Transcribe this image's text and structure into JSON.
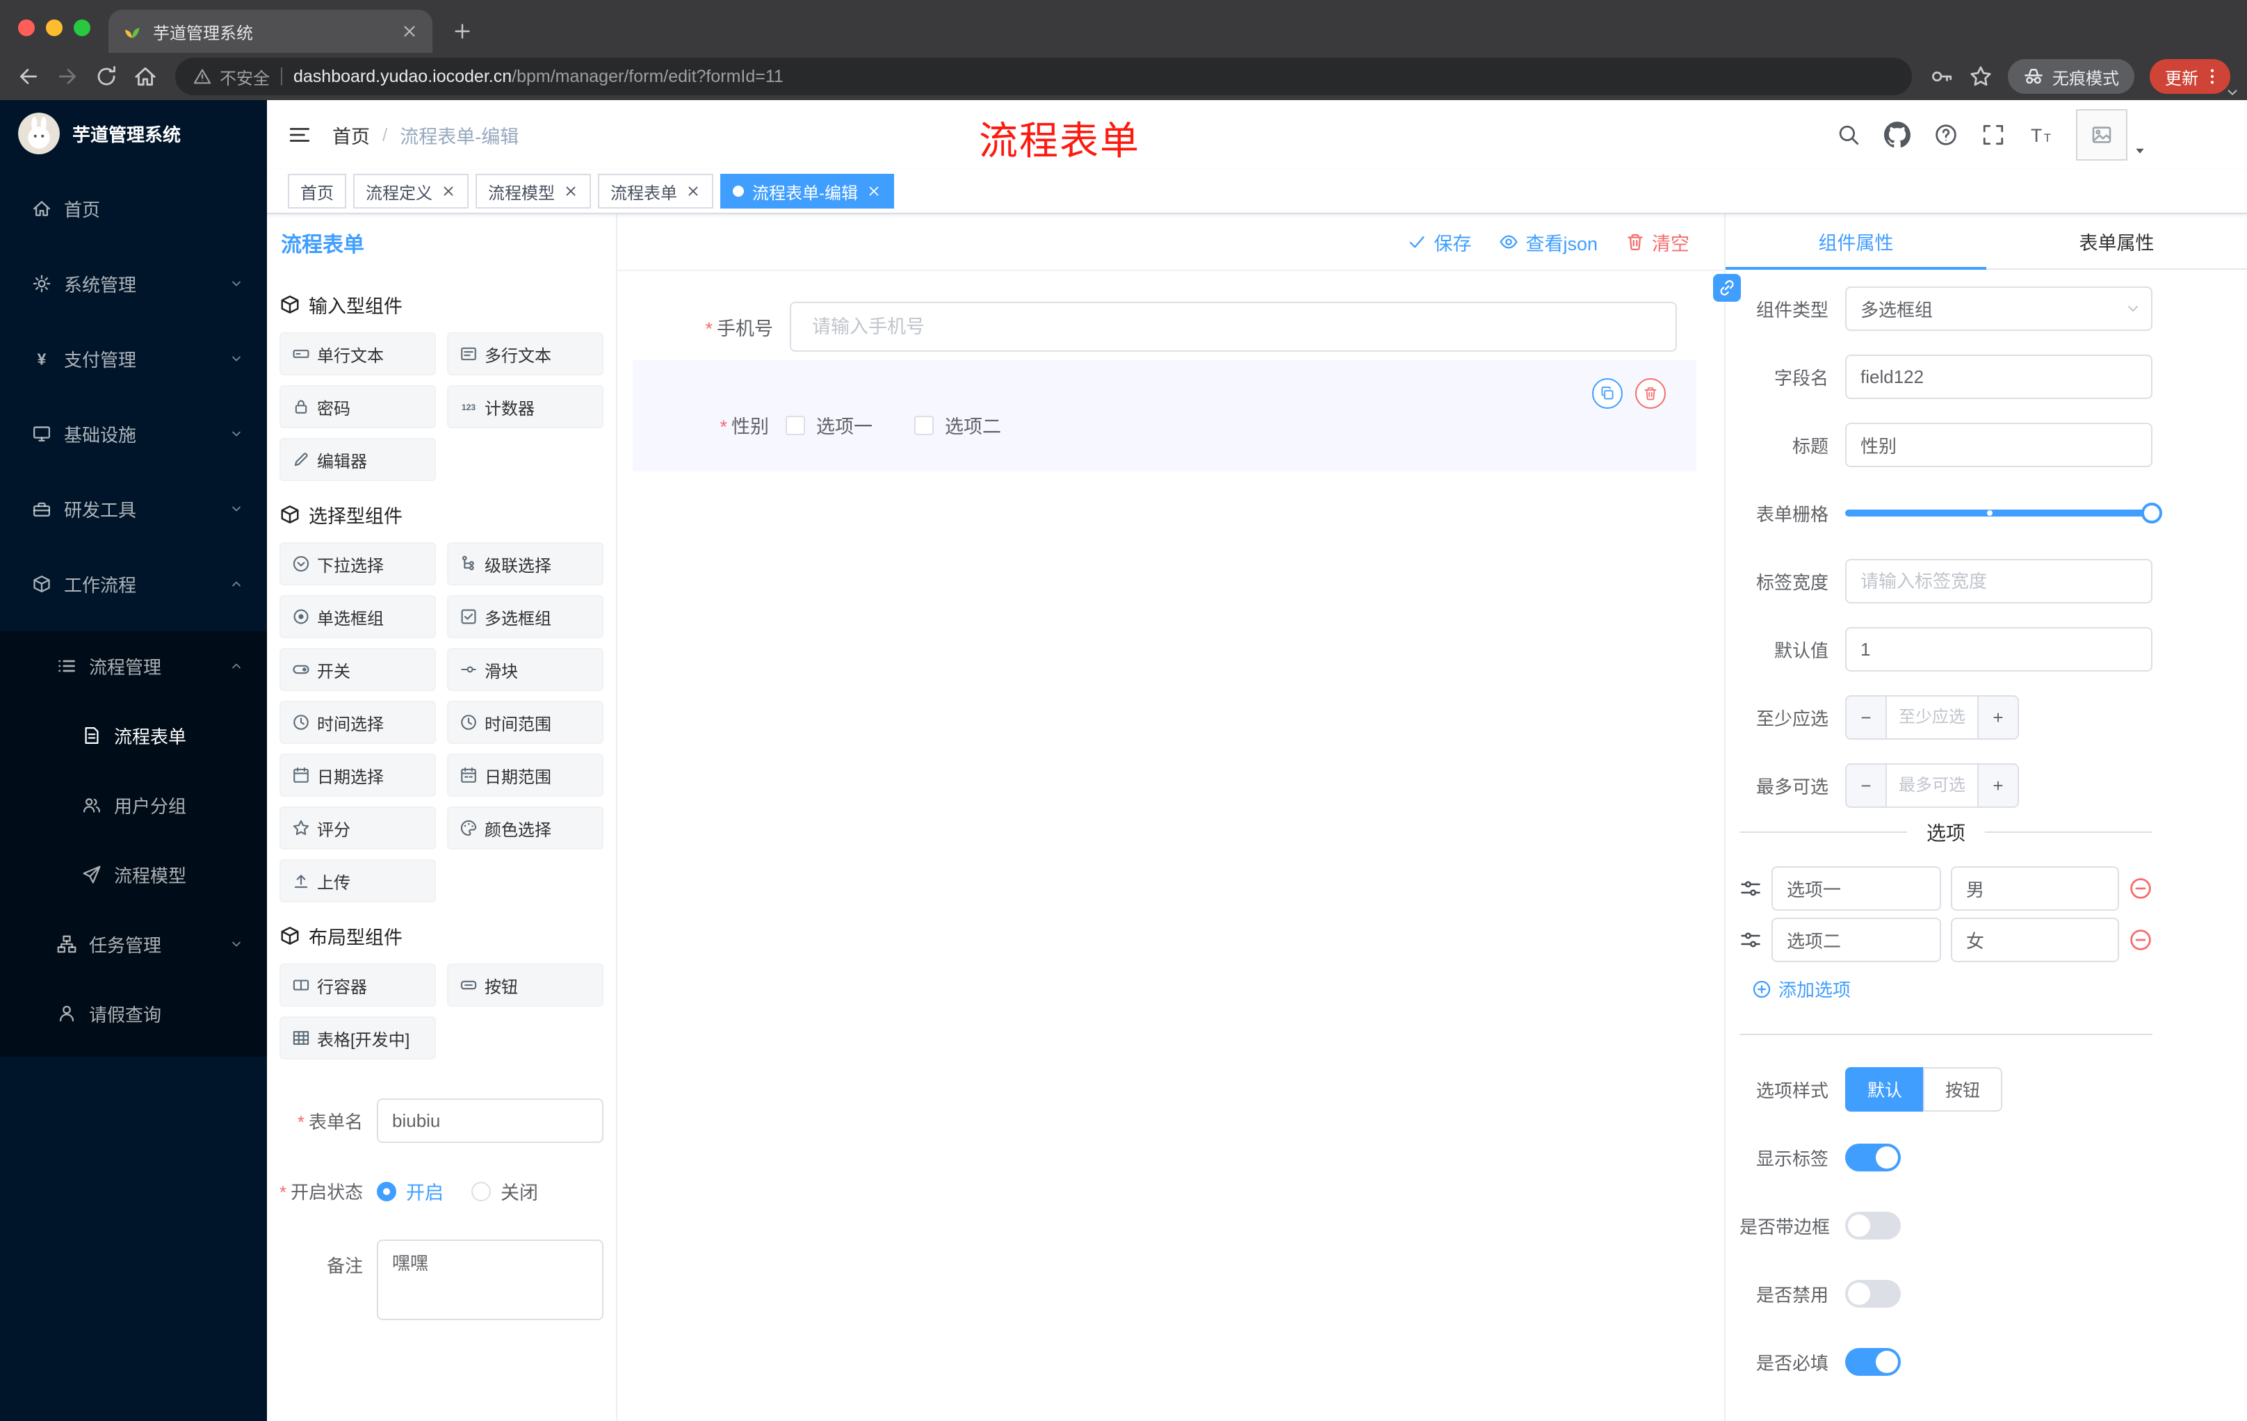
{
  "browser": {
    "tab_title": "芋道管理系统",
    "security_label": "不安全",
    "url_host": "dashboard.yudao.iocoder.cn",
    "url_path": "/bpm/manager/form/edit?formId=11",
    "incognito_label": "无痕模式",
    "update_label": "更新"
  },
  "sidebar": {
    "logo_title": "芋道管理系统",
    "menu": [
      {
        "id": "home",
        "label": "首页",
        "icon": "home",
        "depth": 0
      },
      {
        "id": "system-mgmt",
        "label": "系统管理",
        "icon": "gear",
        "depth": 0,
        "chevron": "down"
      },
      {
        "id": "payment-mgmt",
        "label": "支付管理",
        "icon": "yen",
        "depth": 0,
        "chevron": "down"
      },
      {
        "id": "infrastructure",
        "label": "基础设施",
        "icon": "monitor",
        "depth": 0,
        "chevron": "down"
      },
      {
        "id": "dev-tools",
        "label": "研发工具",
        "icon": "toolbox",
        "depth": 0,
        "chevron": "down"
      },
      {
        "id": "workflow",
        "label": "工作流程",
        "icon": "cube",
        "depth": 0,
        "chevron": "up"
      },
      {
        "id": "process-mgmt",
        "label": "流程管理",
        "icon": "list",
        "depth": 1,
        "chevron": "up"
      },
      {
        "id": "process-form",
        "label": "流程表单",
        "icon": "document",
        "depth": 2,
        "active": true
      },
      {
        "id": "user-group",
        "label": "用户分组",
        "icon": "users",
        "depth": 2
      },
      {
        "id": "process-model",
        "label": "流程模型",
        "icon": "plane",
        "depth": 2
      },
      {
        "id": "task-mgmt",
        "label": "任务管理",
        "icon": "tree",
        "depth": 1,
        "chevron": "down"
      },
      {
        "id": "leave-query",
        "label": "请假查询",
        "icon": "user",
        "depth": 1
      }
    ]
  },
  "navbar": {
    "breadcrumb_home": "首页",
    "breadcrumb_separator": "/",
    "breadcrumb_current": "流程表单-编辑",
    "annotation": "流程表单"
  },
  "tags": [
    {
      "label": "首页",
      "closable": false,
      "active": false
    },
    {
      "label": "流程定义",
      "closable": true,
      "active": false
    },
    {
      "label": "流程模型",
      "closable": true,
      "active": false
    },
    {
      "label": "流程表单",
      "closable": true,
      "active": false
    },
    {
      "label": "流程表单-编辑",
      "closable": true,
      "active": true
    }
  ],
  "designer": {
    "title": "流程表单",
    "actions": {
      "save": "保存",
      "view_json": "查看json",
      "clear": "清空"
    },
    "groups": [
      {
        "title": "输入型组件",
        "items": [
          {
            "label": "单行文本",
            "icon": "input"
          },
          {
            "label": "多行文本",
            "icon": "textarea"
          },
          {
            "label": "密码",
            "icon": "lock"
          },
          {
            "label": "计数器",
            "icon": "counter"
          },
          {
            "label": "编辑器",
            "icon": "pencil"
          }
        ]
      },
      {
        "title": "选择型组件",
        "items": [
          {
            "label": "下拉选择",
            "icon": "select"
          },
          {
            "label": "级联选择",
            "icon": "cascade"
          },
          {
            "label": "单选框组",
            "icon": "radio"
          },
          {
            "label": "多选框组",
            "icon": "checkbox"
          },
          {
            "label": "开关",
            "icon": "switch"
          },
          {
            "label": "滑块",
            "icon": "slider"
          },
          {
            "label": "时间选择",
            "icon": "clock"
          },
          {
            "label": "时间范围",
            "icon": "clock-range"
          },
          {
            "label": "日期选择",
            "icon": "calendar"
          },
          {
            "label": "日期范围",
            "icon": "calendar-range"
          },
          {
            "label": "评分",
            "icon": "star"
          },
          {
            "label": "颜色选择",
            "icon": "palette"
          },
          {
            "label": "上传",
            "icon": "upload"
          }
        ]
      },
      {
        "title": "布局型组件",
        "items": [
          {
            "label": "行容器",
            "icon": "row"
          },
          {
            "label": "按钮",
            "icon": "button"
          },
          {
            "label": "表格[开发中]",
            "icon": "table"
          }
        ]
      }
    ],
    "meta": {
      "name_label": "表单名",
      "name_value": "biubiu",
      "status_label": "开启状态",
      "status_on": "开启",
      "status_off": "关闭",
      "remark_label": "备注",
      "remark_value": "嘿嘿"
    },
    "canvas": {
      "phone_label": "手机号",
      "phone_placeholder": "请输入手机号",
      "gender_label": "性别",
      "gender_options": [
        "选项一",
        "选项二"
      ]
    }
  },
  "props": {
    "tabs": [
      "组件属性",
      "表单属性"
    ],
    "component_type": {
      "label": "组件类型",
      "value": "多选框组"
    },
    "field_name": {
      "label": "字段名",
      "value": "field122"
    },
    "title_field": {
      "label": "标题",
      "value": "性别"
    },
    "grid": {
      "label": "表单栅格"
    },
    "label_width": {
      "label": "标签宽度",
      "placeholder": "请输入标签宽度"
    },
    "default_value": {
      "label": "默认值",
      "value": "1"
    },
    "min_select": {
      "label": "至少应选",
      "placeholder": "至少应选"
    },
    "max_select": {
      "label": "最多可选",
      "placeholder": "最多可选"
    },
    "stepper": {
      "minus": "−",
      "plus": "+"
    },
    "options": {
      "divider": "选项",
      "rows": [
        {
          "name": "选项一",
          "value": "男"
        },
        {
          "name": "选项二",
          "value": "女"
        }
      ],
      "add_label": "添加选项"
    },
    "option_style": {
      "label": "选项样式",
      "choices": [
        "默认",
        "按钮"
      ],
      "active": "默认"
    },
    "switches": [
      {
        "id": "show-label",
        "label": "显示标签",
        "on": true
      },
      {
        "id": "with-border",
        "label": "是否带边框",
        "on": false
      },
      {
        "id": "disabled",
        "label": "是否禁用",
        "on": false
      },
      {
        "id": "required",
        "label": "是否必填",
        "on": true
      }
    ]
  },
  "colors": {
    "primary": "#409eff",
    "danger": "#f56c6c",
    "sidebar_bg": "#001529",
    "submenu_bg": "#000c17",
    "annotation_red": "#fd1a0f",
    "selected_block_bg": "#f6f7ff"
  }
}
